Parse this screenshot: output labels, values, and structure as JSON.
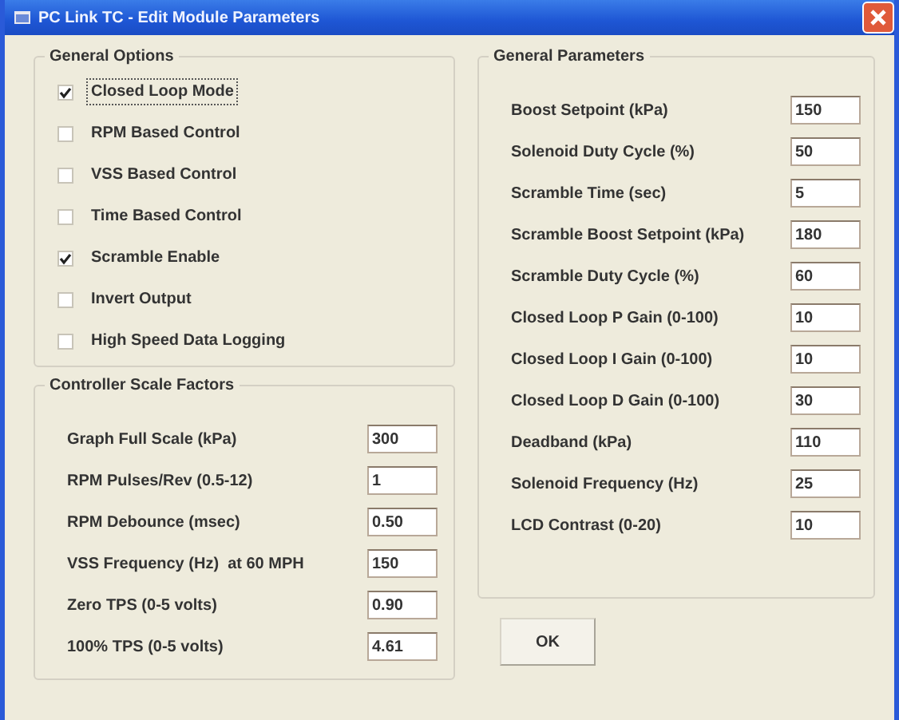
{
  "window": {
    "title": "PC Link TC - Edit Module Parameters"
  },
  "general_options": {
    "title": "General Options",
    "items": [
      {
        "label": "Closed Loop Mode",
        "checked": true,
        "focused": true
      },
      {
        "label": "RPM Based Control",
        "checked": false,
        "focused": false
      },
      {
        "label": "VSS Based Control",
        "checked": false,
        "focused": false
      },
      {
        "label": "Time Based Control",
        "checked": false,
        "focused": false
      },
      {
        "label": "Scramble Enable",
        "checked": true,
        "focused": false
      },
      {
        "label": "Invert Output",
        "checked": false,
        "focused": false
      },
      {
        "label": "High Speed Data Logging",
        "checked": false,
        "focused": false
      }
    ]
  },
  "controller_scale_factors": {
    "title": "Controller Scale Factors",
    "fields": [
      {
        "label": "Graph Full Scale (kPa)",
        "value": "300"
      },
      {
        "label": "RPM Pulses/Rev (0.5-12)",
        "value": "1"
      },
      {
        "label": "RPM Debounce (msec)",
        "value": "0.50"
      },
      {
        "label": "VSS Frequency (Hz)  at 60 MPH",
        "value": "150"
      },
      {
        "label": "Zero TPS (0-5 volts)",
        "value": "0.90"
      },
      {
        "label": "100% TPS (0-5 volts)",
        "value": "4.61"
      }
    ]
  },
  "general_parameters": {
    "title": "General Parameters",
    "fields": [
      {
        "label": "Boost Setpoint (kPa)",
        "value": "150"
      },
      {
        "label": "Solenoid Duty Cycle (%)",
        "value": "50"
      },
      {
        "label": "Scramble Time (sec)",
        "value": "5"
      },
      {
        "label": "Scramble Boost Setpoint (kPa)",
        "value": "180"
      },
      {
        "label": "Scramble Duty Cycle (%)",
        "value": "60"
      },
      {
        "label": "Closed Loop P Gain (0-100)",
        "value": "10"
      },
      {
        "label": "Closed Loop I Gain (0-100)",
        "value": "10"
      },
      {
        "label": "Closed Loop D Gain (0-100)",
        "value": "30"
      },
      {
        "label": "Deadband (kPa)",
        "value": "110"
      },
      {
        "label": "Solenoid Frequency (Hz)",
        "value": "25"
      },
      {
        "label": "LCD Contrast (0-20)",
        "value": "10"
      }
    ]
  },
  "buttons": [
    "OK"
  ]
}
